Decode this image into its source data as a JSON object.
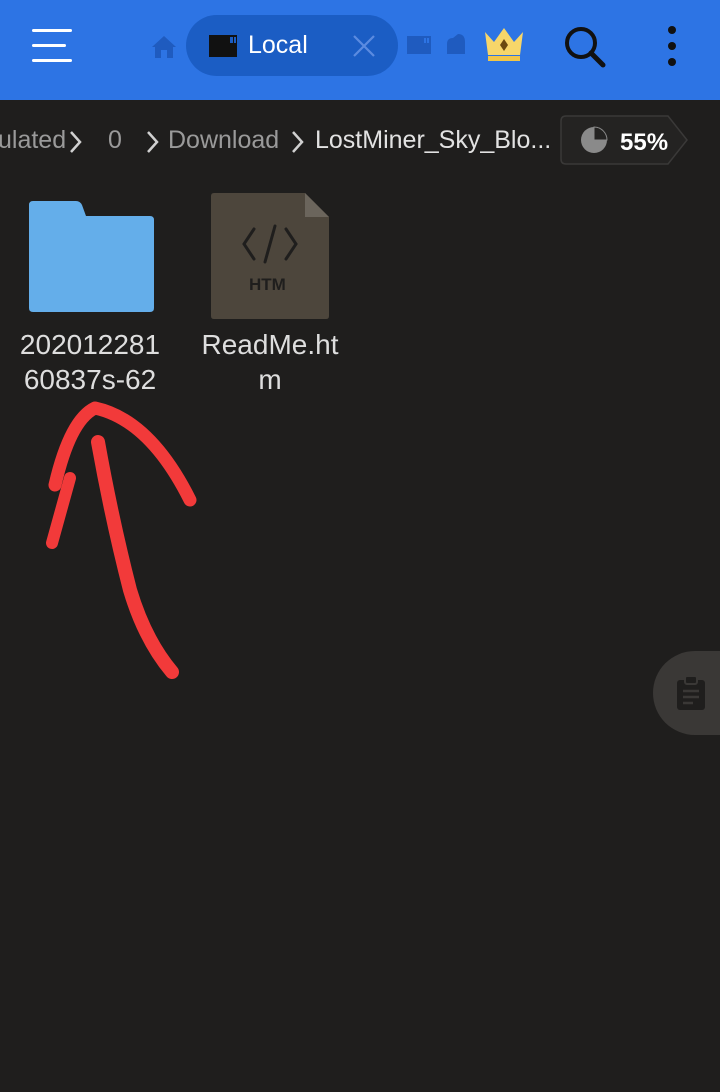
{
  "toolbar": {
    "active_tab_label": "Local",
    "icons": [
      "menu-icon",
      "home-icon",
      "sd-card-icon",
      "close-icon",
      "sd-card-icon",
      "cloud-icon",
      "crown-icon",
      "search-icon",
      "more-vertical-icon"
    ]
  },
  "breadcrumb": {
    "items": [
      "ulated",
      "0",
      "Download",
      "LostMiner_Sky_Blo..."
    ],
    "storage_percent": "55%"
  },
  "files": [
    {
      "name_line1": "202012281",
      "name_line2": "60837s-62",
      "type": "folder"
    },
    {
      "name_line1": "ReadMe.ht",
      "name_line2": "m",
      "type": "file",
      "badge": "HTM"
    }
  ],
  "colors": {
    "toolbar_bg": "#2d74e4",
    "tab_bg": "#1b5dc4",
    "background": "#1f1e1d",
    "folder": "#64aeea",
    "annotation_arrow": "#f23a3a"
  }
}
